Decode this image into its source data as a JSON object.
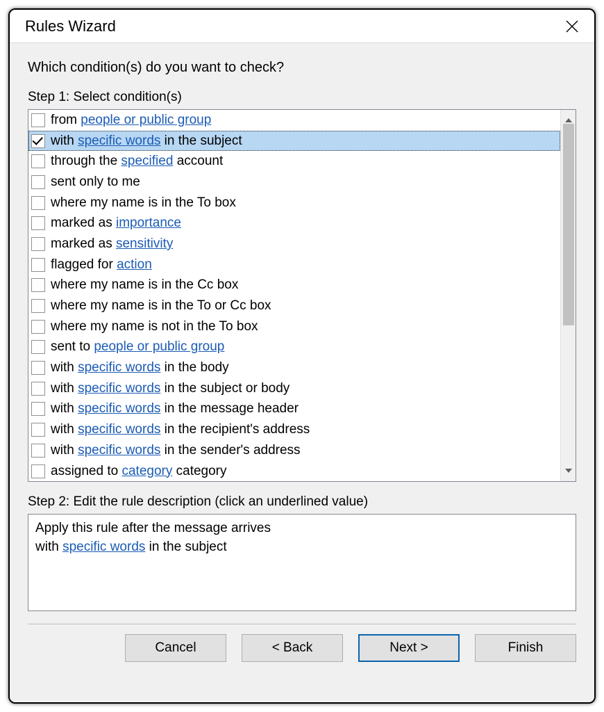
{
  "dialog": {
    "title": "Rules Wizard",
    "question": "Which condition(s) do you want to check?",
    "step1_label": "Step 1: Select condition(s)",
    "step2_label": "Step 2: Edit the rule description (click an underlined value)"
  },
  "conditions": [
    {
      "checked": false,
      "selected": false,
      "parts": [
        {
          "t": "from "
        },
        {
          "t": "people or public group",
          "link": true
        }
      ]
    },
    {
      "checked": true,
      "selected": true,
      "parts": [
        {
          "t": "with "
        },
        {
          "t": "specific words",
          "link": true
        },
        {
          "t": " in the subject"
        }
      ]
    },
    {
      "checked": false,
      "selected": false,
      "parts": [
        {
          "t": "through the "
        },
        {
          "t": "specified",
          "link": true
        },
        {
          "t": " account"
        }
      ]
    },
    {
      "checked": false,
      "selected": false,
      "parts": [
        {
          "t": "sent only to me"
        }
      ]
    },
    {
      "checked": false,
      "selected": false,
      "parts": [
        {
          "t": "where my name is in the To box"
        }
      ]
    },
    {
      "checked": false,
      "selected": false,
      "parts": [
        {
          "t": "marked as "
        },
        {
          "t": "importance",
          "link": true
        }
      ]
    },
    {
      "checked": false,
      "selected": false,
      "parts": [
        {
          "t": "marked as "
        },
        {
          "t": "sensitivity",
          "link": true
        }
      ]
    },
    {
      "checked": false,
      "selected": false,
      "parts": [
        {
          "t": "flagged for "
        },
        {
          "t": "action",
          "link": true
        }
      ]
    },
    {
      "checked": false,
      "selected": false,
      "parts": [
        {
          "t": "where my name is in the Cc box"
        }
      ]
    },
    {
      "checked": false,
      "selected": false,
      "parts": [
        {
          "t": "where my name is in the To or Cc box"
        }
      ]
    },
    {
      "checked": false,
      "selected": false,
      "parts": [
        {
          "t": "where my name is not in the To box"
        }
      ]
    },
    {
      "checked": false,
      "selected": false,
      "parts": [
        {
          "t": "sent to "
        },
        {
          "t": "people or public group",
          "link": true
        }
      ]
    },
    {
      "checked": false,
      "selected": false,
      "parts": [
        {
          "t": "with "
        },
        {
          "t": "specific words",
          "link": true
        },
        {
          "t": " in the body"
        }
      ]
    },
    {
      "checked": false,
      "selected": false,
      "parts": [
        {
          "t": "with "
        },
        {
          "t": "specific words",
          "link": true
        },
        {
          "t": " in the subject or body"
        }
      ]
    },
    {
      "checked": false,
      "selected": false,
      "parts": [
        {
          "t": "with "
        },
        {
          "t": "specific words",
          "link": true
        },
        {
          "t": " in the message header"
        }
      ]
    },
    {
      "checked": false,
      "selected": false,
      "parts": [
        {
          "t": "with "
        },
        {
          "t": "specific words",
          "link": true
        },
        {
          "t": " in the recipient's address"
        }
      ]
    },
    {
      "checked": false,
      "selected": false,
      "parts": [
        {
          "t": "with "
        },
        {
          "t": "specific words",
          "link": true
        },
        {
          "t": " in the sender's address"
        }
      ]
    },
    {
      "checked": false,
      "selected": false,
      "parts": [
        {
          "t": "assigned to "
        },
        {
          "t": "category",
          "link": true
        },
        {
          "t": " category"
        }
      ]
    }
  ],
  "description": {
    "line1": "Apply this rule after the message arrives",
    "line2_pre": "with ",
    "line2_link": "specific words",
    "line2_post": " in the subject"
  },
  "buttons": {
    "cancel": "Cancel",
    "back": "< Back",
    "next": "Next >",
    "finish": "Finish"
  }
}
